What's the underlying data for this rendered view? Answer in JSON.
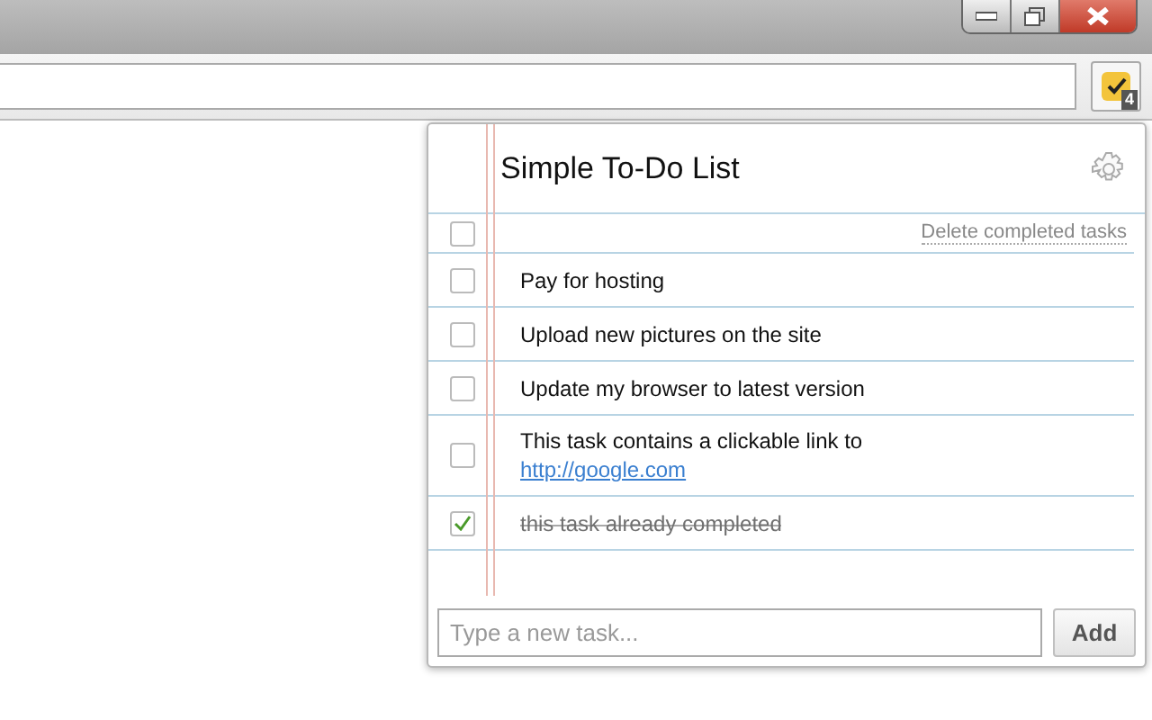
{
  "extension_button": {
    "badge": "4"
  },
  "popup": {
    "title": "Simple To-Do List",
    "toolbar_row": {
      "checked": false,
      "link": "Delete completed tasks"
    },
    "tasks": [
      {
        "text": "Pay for hosting",
        "checked": false
      },
      {
        "text": "Upload new pictures on the site",
        "checked": false
      },
      {
        "text": "Update my browser to latest version",
        "checked": false
      },
      {
        "text": "This task contains a clickable link to",
        "link": "http://google.com",
        "checked": false
      },
      {
        "text": "this task already completed",
        "checked": true
      }
    ],
    "new_task": {
      "placeholder": "Type a new task..."
    },
    "add_button": "Add"
  }
}
